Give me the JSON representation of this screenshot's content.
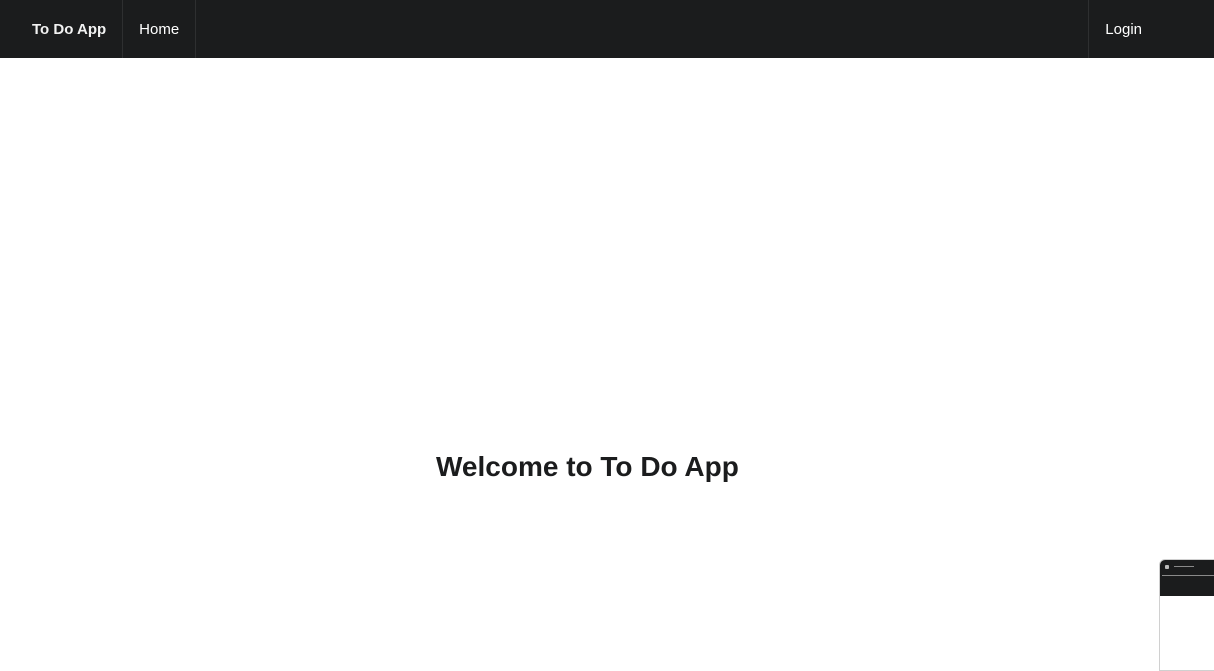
{
  "navbar": {
    "brand": "To Do App",
    "items": [
      {
        "label": "Home"
      }
    ],
    "login_label": "Login"
  },
  "main": {
    "heading": "Welcome to To Do App"
  },
  "colors": {
    "navbar_bg": "#1b1c1d",
    "page_bg": "#ffffff",
    "heading": "#1b1c1d"
  }
}
